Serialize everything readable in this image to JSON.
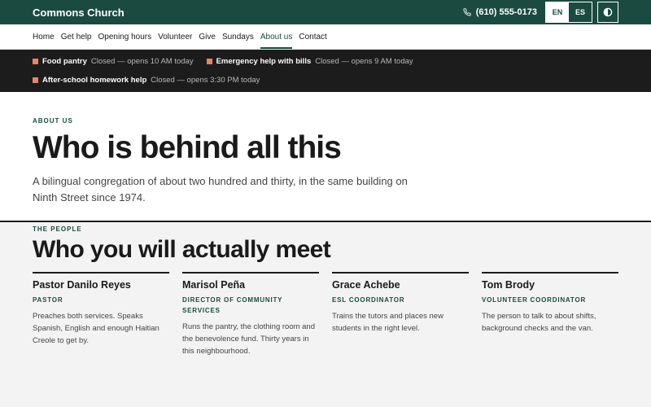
{
  "header": {
    "brand": "Commons Church",
    "phone": "(610) 555-0173",
    "lang_en": "EN",
    "lang_es": "ES",
    "contrast_icon": "contrast-icon",
    "phone_icon": "phone-icon"
  },
  "nav": {
    "items": [
      "Home",
      "Get help",
      "Opening hours",
      "Volunteer",
      "Give",
      "Sundays",
      "About us",
      "Contact"
    ],
    "current": "About us"
  },
  "status": {
    "items": [
      {
        "name": "Food pantry",
        "state": "Closed — opens 10 AM today"
      },
      {
        "name": "Emergency help with bills",
        "state": "Closed — opens 9 AM today"
      },
      {
        "name": "After-school homework help",
        "state": "Closed — opens 3:30 PM today"
      }
    ],
    "indicator_color": "#e8836c"
  },
  "about": {
    "eyebrow": "ABOUT US",
    "title": "Who is behind all this",
    "lede": "A bilingual congregation of about two hundred and thirty, in the same building on Ninth Street since 1974."
  },
  "people": {
    "eyebrow": "THE PEOPLE",
    "title": "Who you will actually meet",
    "cards": [
      {
        "name": "Pastor Danilo Reyes",
        "role": "PASTOR",
        "desc": "Preaches both services. Speaks Spanish, English and enough Haitian Creole to get by."
      },
      {
        "name": "Marisol Peña",
        "role": "DIRECTOR OF COMMUNITY SERVICES",
        "desc": "Runs the pantry, the clothing room and the benevolence fund. Thirty years in this neighbourhood."
      },
      {
        "name": "Grace Achebe",
        "role": "ESL COORDINATOR",
        "desc": "Trains the tutors and places new students in the right level."
      },
      {
        "name": "Tom Brody",
        "role": "VOLUNTEER COORDINATOR",
        "desc": "The person to talk to about shifts, background checks and the van."
      }
    ]
  },
  "colors": {
    "brand": "#1b4a40",
    "dark": "#1c1c1c",
    "accent": "#e8836c"
  }
}
